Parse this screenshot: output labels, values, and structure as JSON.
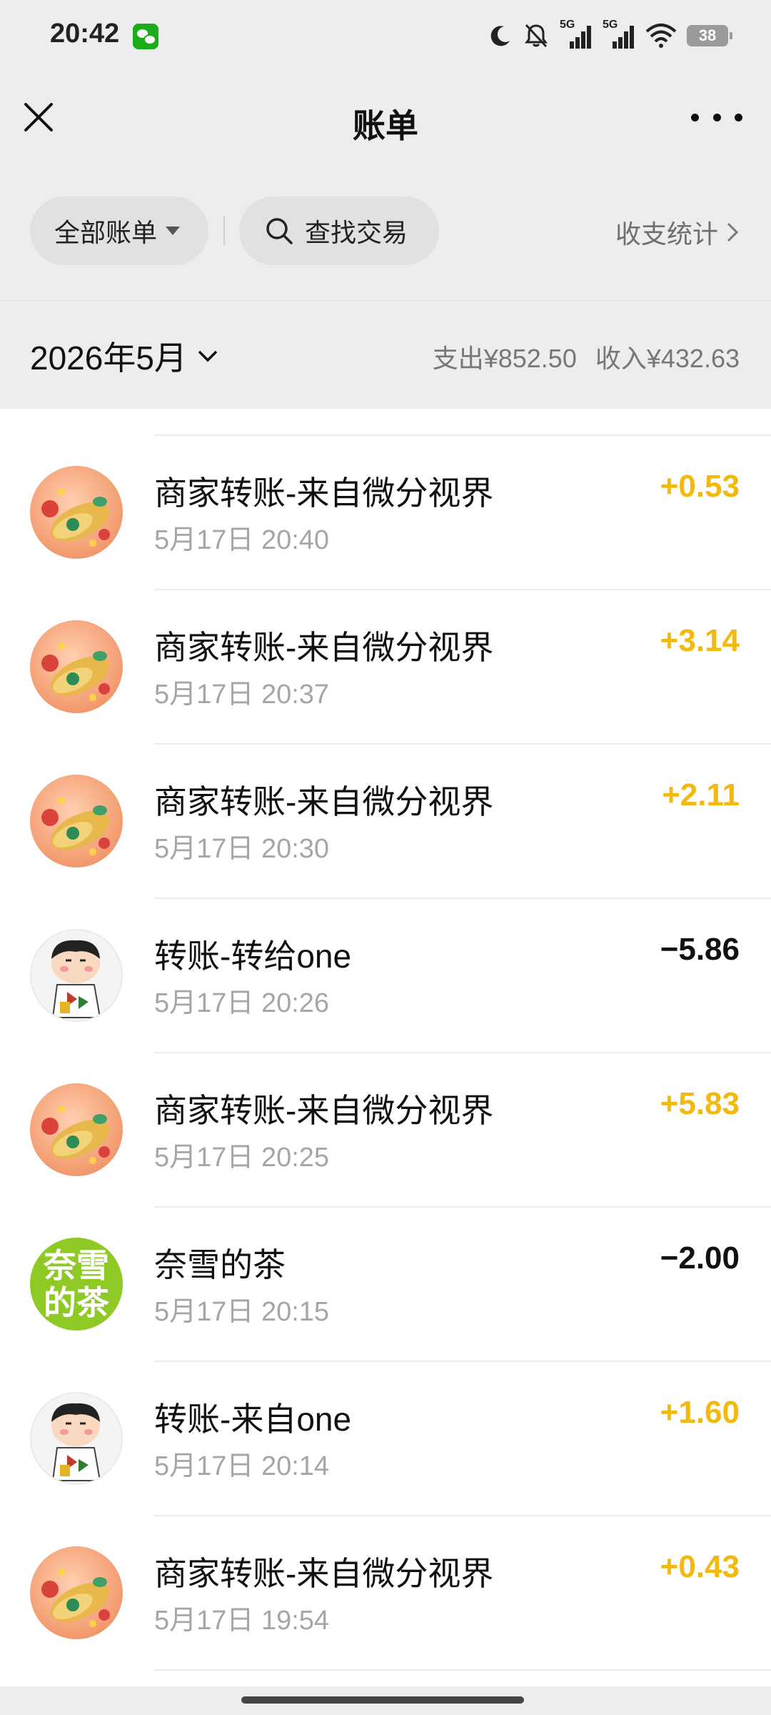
{
  "status_bar": {
    "time": "20:42",
    "network_1": "5G",
    "network_2": "5G",
    "battery": "38",
    "icons": [
      "wechat-icon",
      "moon-icon",
      "mute-bell-icon",
      "signal-icon",
      "signal-icon",
      "wifi-icon",
      "battery-icon"
    ]
  },
  "nav": {
    "title": "账单",
    "close_icon": "close-icon",
    "more_icon": "more-icon"
  },
  "filters": {
    "all_bills_label": "全部账单",
    "search_label": "查找交易",
    "stats_label": "收支统计"
  },
  "month_header": {
    "month": "2026年5月",
    "expense": "支出¥852.50",
    "income": "收入¥432.63"
  },
  "colors": {
    "income_amount": "#f4b90f",
    "expense_amount": "#111111",
    "background": "#ededed"
  },
  "transactions": [
    {
      "title": "商家转账-来自微分视界",
      "time": "5月17日 20:40",
      "amount": "+0.53",
      "type": "income",
      "avatar": "merchant-avatar"
    },
    {
      "title": "商家转账-来自微分视界",
      "time": "5月17日 20:37",
      "amount": "+3.14",
      "type": "income",
      "avatar": "merchant-avatar"
    },
    {
      "title": "商家转账-来自微分视界",
      "time": "5月17日 20:30",
      "amount": "+2.11",
      "type": "income",
      "avatar": "merchant-avatar"
    },
    {
      "title": "转账-转给one",
      "time": "5月17日 20:26",
      "amount": "−5.86",
      "type": "expense",
      "avatar": "cartoon-avatar"
    },
    {
      "title": "商家转账-来自微分视界",
      "time": "5月17日 20:25",
      "amount": "+5.83",
      "type": "income",
      "avatar": "merchant-avatar"
    },
    {
      "title": "奈雪的茶",
      "time": "5月17日 20:15",
      "amount": "−2.00",
      "type": "expense",
      "avatar": "nayuki-logo",
      "avatar_text_1": "奈雪",
      "avatar_text_2": "的茶"
    },
    {
      "title": "转账-来自one",
      "time": "5月17日 20:14",
      "amount": "+1.60",
      "type": "income",
      "avatar": "cartoon-avatar"
    },
    {
      "title": "商家转账-来自微分视界",
      "time": "5月17日 19:54",
      "amount": "+0.43",
      "type": "income",
      "avatar": "merchant-avatar"
    }
  ]
}
